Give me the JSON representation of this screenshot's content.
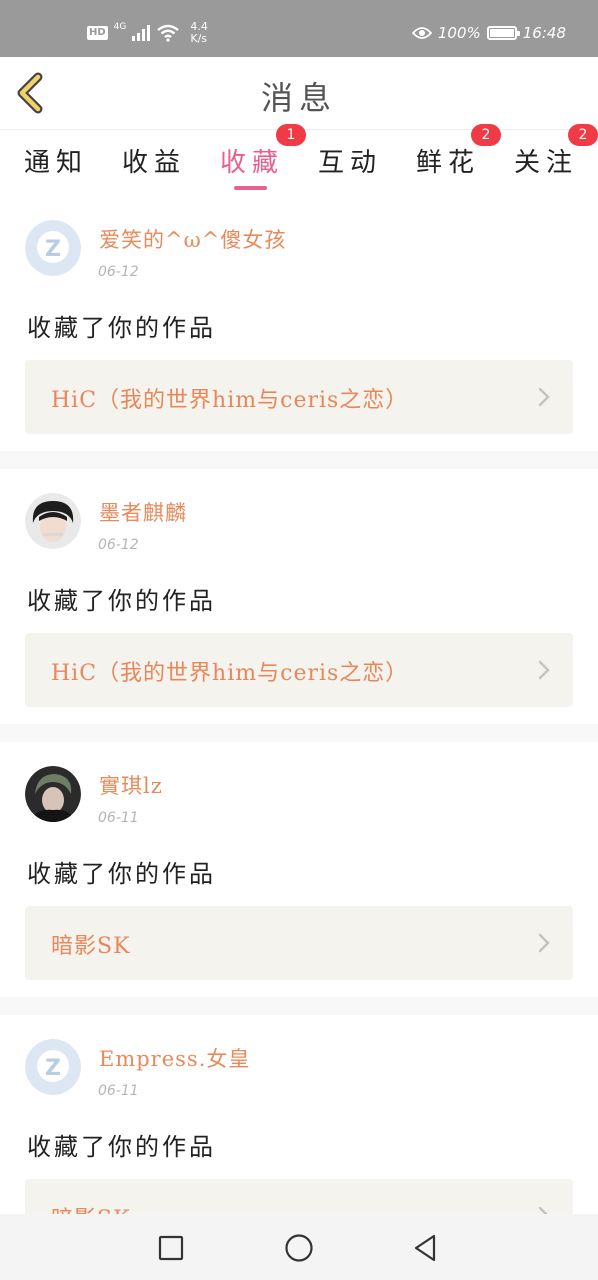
{
  "status_bar": {
    "hd": "HD",
    "network": "4G",
    "speed_value": "4.4",
    "speed_unit": "K/s",
    "battery": "100%",
    "battery_level": 1.0,
    "time": "16:48"
  },
  "header": {
    "title": "消息"
  },
  "tabs": [
    {
      "label": "通知",
      "badge": ""
    },
    {
      "label": "收益",
      "badge": ""
    },
    {
      "label": "收藏",
      "badge": "1",
      "active": true
    },
    {
      "label": "互动",
      "badge": ""
    },
    {
      "label": "鲜花",
      "badge": "2"
    },
    {
      "label": "关注",
      "badge": "2"
    }
  ],
  "messages": [
    {
      "user": "爱笑的^ω^傻女孩",
      "date": "06-12",
      "action": "收藏了你的作品",
      "work": "HiC（我的世界him与ceris之恋）",
      "avatar": "default-avatar"
    },
    {
      "user": "墨者麒麟",
      "date": "06-12",
      "action": "收藏了你的作品",
      "work": "HiC（我的世界him与ceris之恋）",
      "avatar": "photo-avatar"
    },
    {
      "user": "實琪lz",
      "date": "06-11",
      "action": "收藏了你的作品",
      "work": "暗影SK",
      "avatar": "photo-avatar"
    },
    {
      "user": "Empress.女皇",
      "date": "06-11",
      "action": "收藏了你的作品",
      "work": "暗影SK",
      "avatar": "default-avatar"
    }
  ],
  "colors": {
    "accent": "#e8608e",
    "username": "#e88a5a",
    "badge": "#f03a46",
    "status_bar": "#9a9a9a",
    "work_box": "#f5f3ee"
  }
}
